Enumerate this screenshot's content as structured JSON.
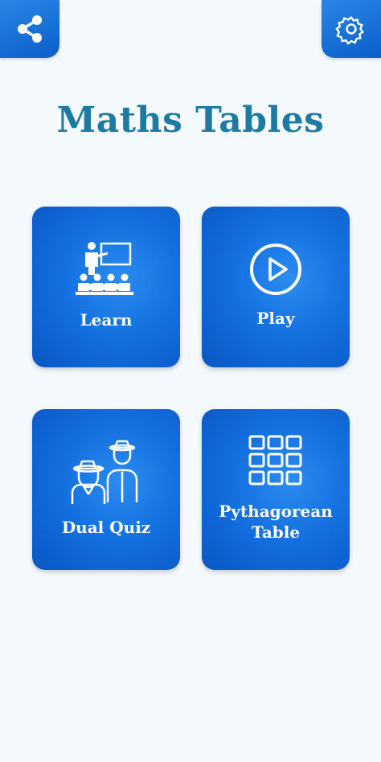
{
  "header": {
    "share_icon": "share-icon",
    "settings_icon": "gear-icon"
  },
  "title": "Maths Tables",
  "menu": {
    "learn": {
      "label": "Learn",
      "icon": "teacher-class-icon"
    },
    "play": {
      "label": "Play",
      "icon": "play-circle-icon"
    },
    "dual_quiz": {
      "label": "Dual Quiz",
      "icon": "two-players-icon"
    },
    "pythagorean": {
      "label_line1": "Pythagorean",
      "label_line2": "Table",
      "icon": "grid-icon"
    }
  },
  "colors": {
    "accent": "#1471e0",
    "title": "#1d7aa3",
    "background": "#f4f9fd"
  }
}
